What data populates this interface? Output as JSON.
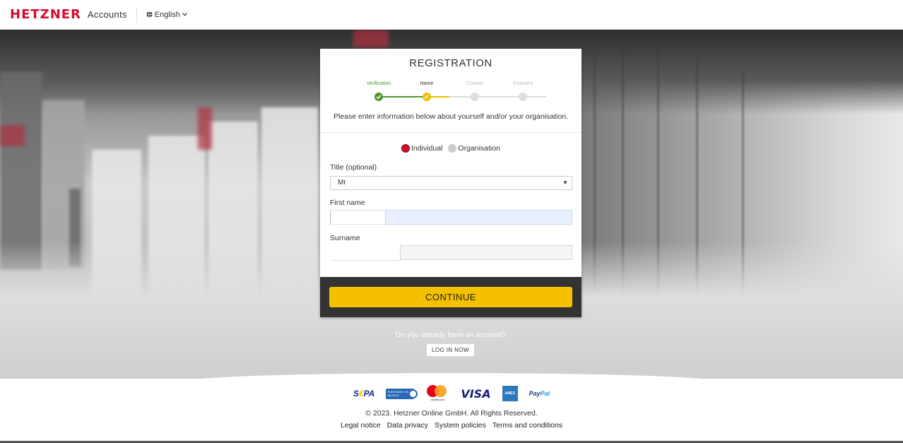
{
  "header": {
    "logo_text": "HETZNER",
    "app_name": "Accounts",
    "language": "English"
  },
  "registration": {
    "title": "REGISTRATION",
    "steps": [
      {
        "label": "Verification",
        "state": "done"
      },
      {
        "label": "Name",
        "state": "active"
      },
      {
        "label": "Contact",
        "state": "pending"
      },
      {
        "label": "Payment",
        "state": "pending"
      }
    ],
    "intro": "Please enter information below about yourself and/or your organisation.",
    "account_type": {
      "options": [
        "Individual",
        "Organisation"
      ],
      "selected": "Individual"
    },
    "title_field": {
      "label": "Title (optional)",
      "value": "Mr"
    },
    "first_name": {
      "label": "First name",
      "value": ""
    },
    "surname": {
      "label": "Surname",
      "value": ""
    },
    "continue_label": "CONTINUE"
  },
  "login_prompt": {
    "text": "Do you already have an account?",
    "button": "LOG IN NOW"
  },
  "footer": {
    "payment_methods": [
      "SEPA",
      "Purchase on invoice",
      "mastercard",
      "VISA",
      "American Express",
      "PayPal"
    ],
    "payment_text": {
      "sepa_a": "S",
      "sepa_b": "€",
      "sepa_c": "PA",
      "invoice": "PURCHASE ON INVOICE",
      "mastercard": "mastercard",
      "visa": "VISA",
      "amex": "AMEX",
      "paypal_a": "Pay",
      "paypal_b": "Pal"
    },
    "copyright": "© 2023. Hetzner Online GmbH. All Rights Reserved.",
    "links": [
      "Legal notice",
      "Data privacy",
      "System policies",
      "Terms and conditions"
    ]
  },
  "colors": {
    "brand_red": "#d50c2d",
    "accent_yellow": "#f5c000",
    "step_done_green": "#4c9a2a",
    "card_bottom": "#333333"
  }
}
